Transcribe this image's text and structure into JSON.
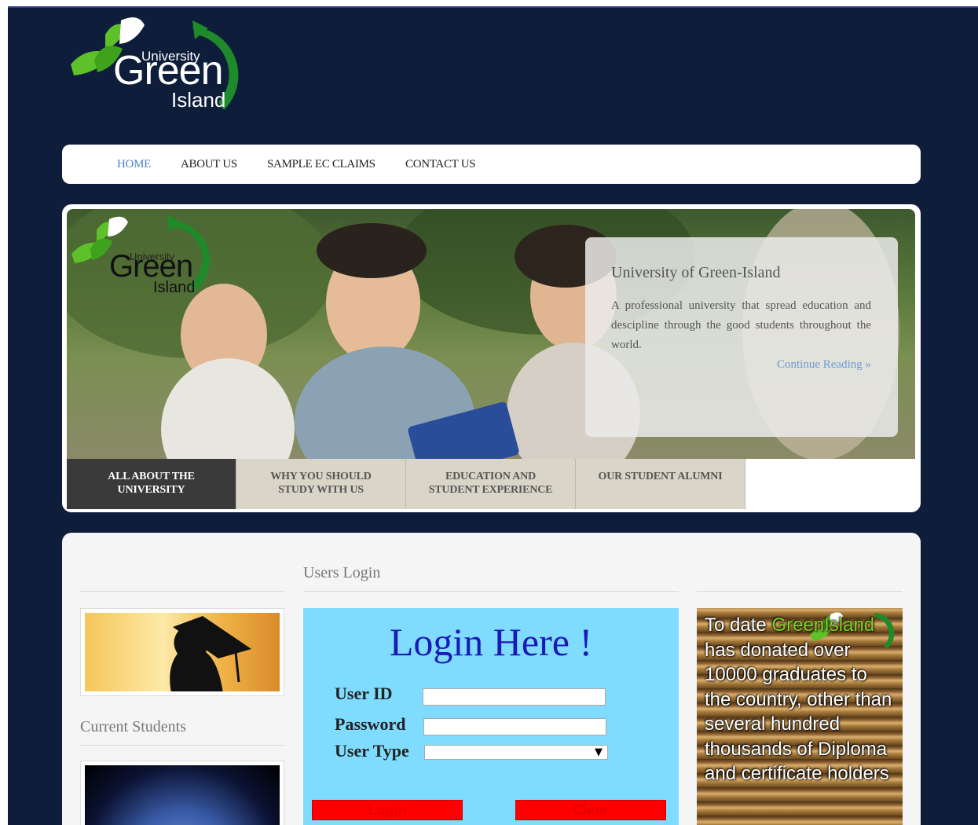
{
  "logo": {
    "line1": "University",
    "line2": "Green",
    "line3": "Island"
  },
  "nav": [
    {
      "label": "HOME",
      "active": true
    },
    {
      "label": "ABOUT US"
    },
    {
      "label": "SAMPLE EC CLAIMS"
    },
    {
      "label": "CONTACT US"
    }
  ],
  "slider": {
    "logo": {
      "line1": "University",
      "line2": "Green",
      "line3": "Island"
    },
    "caption_title": "University of Green-Island",
    "caption_text": "A professional university that spread education and descipline through the good students throughout the world.",
    "caption_link": "Continue Reading »",
    "tabs": [
      {
        "label_1": "ALL ABOUT THE",
        "label_2": "UNIVERSITY",
        "active": true
      },
      {
        "label_1": "WHY YOU SHOULD",
        "label_2": "STUDY WITH US"
      },
      {
        "label_1": "EDUCATION AND",
        "label_2": "STUDENT EXPERIENCE"
      },
      {
        "label_1": "OUR STUDENT ALUMNI",
        "label_2": ""
      }
    ]
  },
  "content": {
    "users_login_heading": "Users Login",
    "current_students": "Current Students",
    "login": {
      "title": "Login Here !",
      "user_id_label": "User ID",
      "password_label": "Password",
      "user_type_label": "User Type",
      "user_id_value": "",
      "password_value": "",
      "user_type_value": "",
      "login_button": "Login",
      "clear_button": "Clear"
    },
    "books_text_1": "To date",
    "books_text_highlight": "GreenIsland",
    "books_text_2": "has donated over 10000 graduates to the country, other than several hundred thousands of Diploma and certificate holders",
    "books_logo": "Green"
  },
  "colors": {
    "page_bg": "#0d1d3a",
    "nav_active": "#4a84c4",
    "login_bg": "#7fdcff",
    "login_title": "#1a1ab5",
    "button_red": "#ff0000",
    "logo_green": "#1f8a2a",
    "leaf_green": "#5ec12a"
  },
  "icons": {
    "select_arrow": "dropdown-arrow-icon"
  }
}
